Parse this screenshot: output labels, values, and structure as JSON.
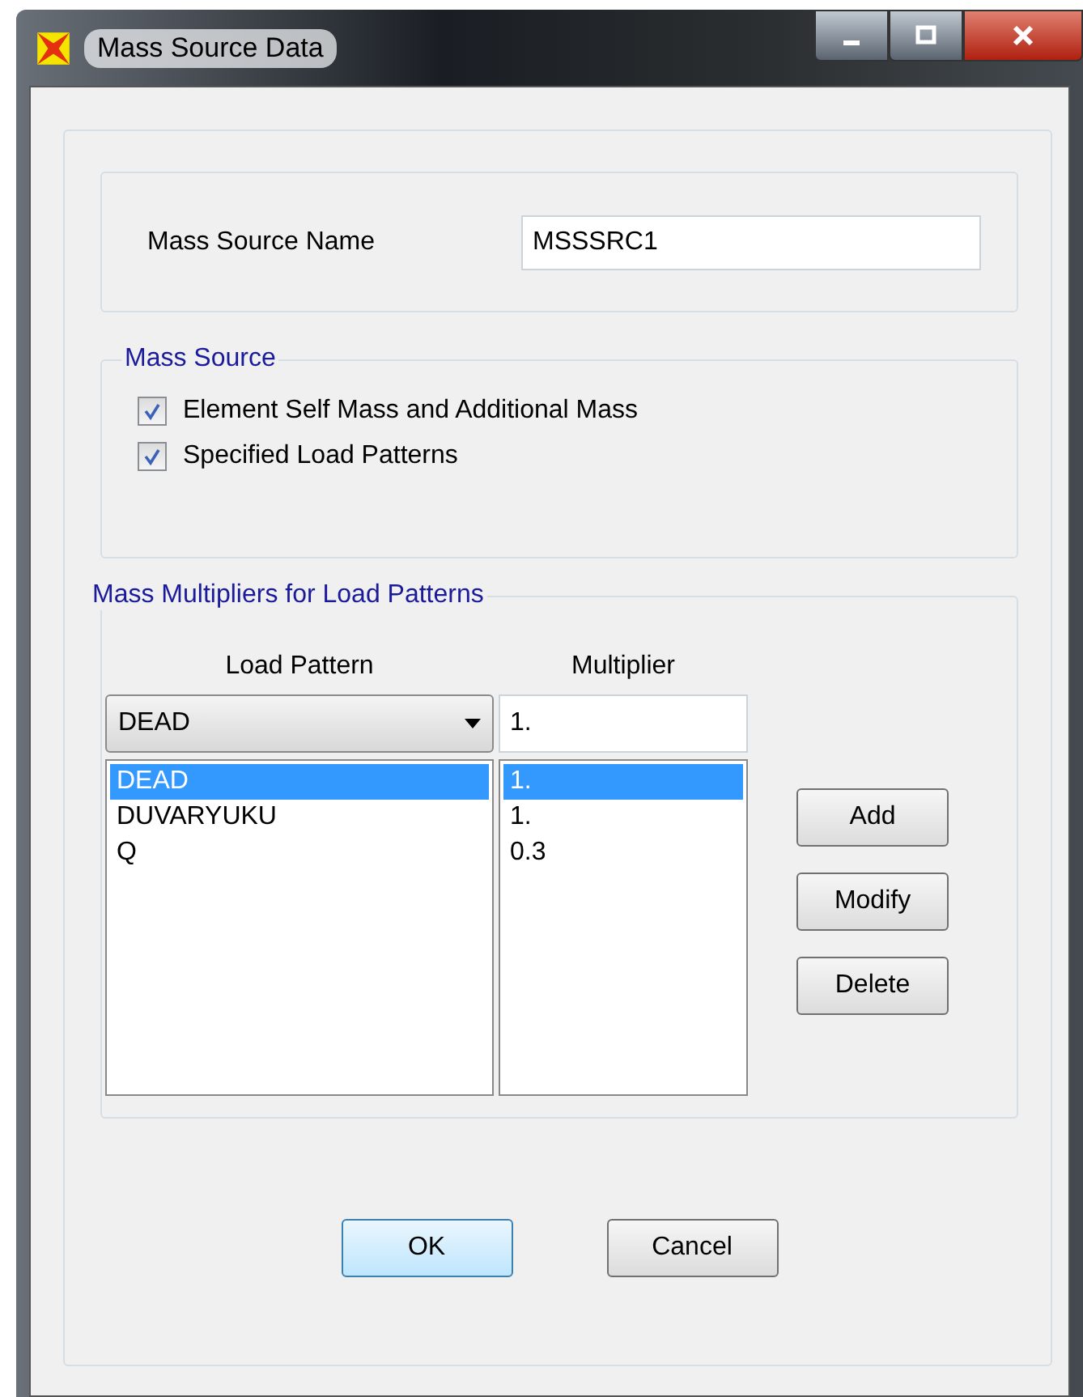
{
  "window": {
    "title": "Mass Source Data"
  },
  "mass_source_name": {
    "label": "Mass Source Name",
    "value": "MSSSRC1"
  },
  "mass_source": {
    "title": "Mass Source",
    "options": [
      {
        "label": "Element Self Mass and Additional Mass",
        "checked": true
      },
      {
        "label": "Specified Load Patterns",
        "checked": true
      }
    ]
  },
  "multipliers": {
    "title": "Mass Multipliers for Load Patterns",
    "column_headers": [
      "Load Pattern",
      "Multiplier"
    ],
    "load_pattern_value": "DEAD",
    "multiplier_value": "1.",
    "load_patterns": [
      {
        "text": "DEAD",
        "selected": true
      },
      {
        "text": "DUVARYUKU",
        "selected": false
      },
      {
        "text": "Q",
        "selected": false
      }
    ],
    "multiplier_list": [
      {
        "text": "1.",
        "selected": true
      },
      {
        "text": "1.",
        "selected": false
      },
      {
        "text": "0.3",
        "selected": false
      }
    ],
    "buttons": [
      "Add",
      "Modify",
      "Delete"
    ]
  },
  "buttons": [
    "OK",
    "Cancel"
  ]
}
